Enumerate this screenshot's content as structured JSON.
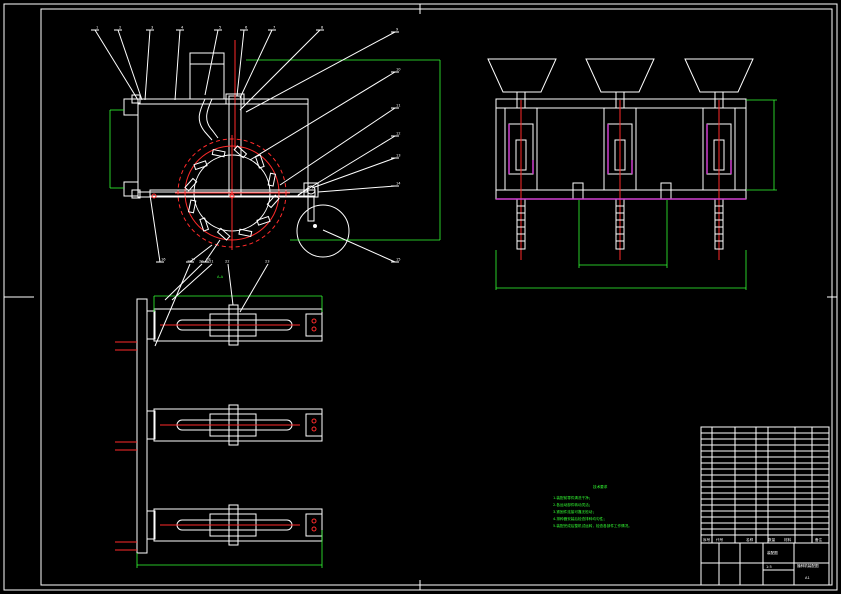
{
  "drawing": {
    "background": "#000000",
    "line_color": "#ffffff",
    "centerline_color": "#ff2a2a",
    "dimension_color": "#33ff33",
    "highlight_color": "#d040d0"
  },
  "balloons_front": [
    "1",
    "2",
    "3",
    "4",
    "5",
    "6",
    "7",
    "8",
    "9",
    "10",
    "11",
    "12",
    "13",
    "14",
    "15",
    "16",
    "17",
    "18"
  ],
  "balloons_plan": [
    "19",
    "20",
    "21",
    "22",
    "23"
  ],
  "tech_requirements": {
    "title": "技术要求",
    "lines": [
      "1.装配前零件清洗干净；",
      "2.各运动部件转动灵活；",
      "3.紧固件连接可靠无松动；",
      "4.排种器安装后检查排种均匀性；",
      "5.装配完成后整机试运转，检查各部件工作情况。"
    ]
  },
  "section_label": "A-A",
  "title_block": {
    "drawing_name": "播种机装配图",
    "stamp": "装配图",
    "scale": "1:5",
    "sheet": "A1",
    "headers": [
      "序号",
      "代号",
      "名称",
      "数量",
      "材料",
      "备注"
    ]
  }
}
